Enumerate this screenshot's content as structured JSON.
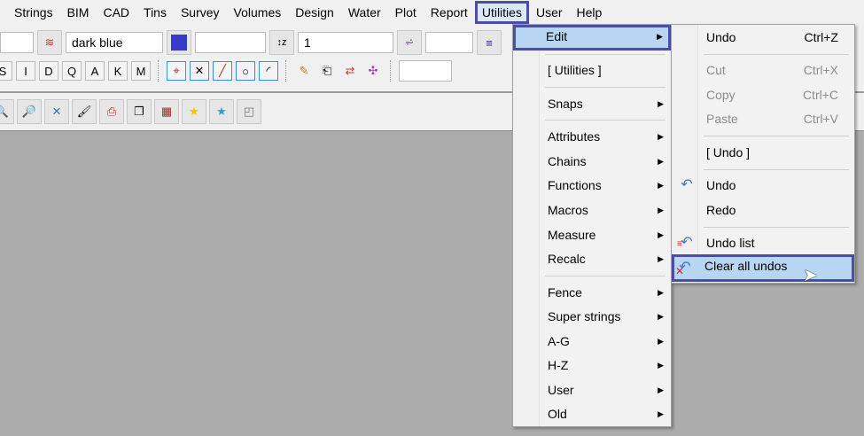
{
  "menubar": [
    "Strings",
    "BIM",
    "CAD",
    "Tins",
    "Survey",
    "Volumes",
    "Design",
    "Water",
    "Plot",
    "Report",
    "Utilities",
    "User",
    "Help"
  ],
  "toolbar": {
    "colour_value": "dark blue",
    "colour_swatch": "#3a3ac8",
    "weight_value": "1",
    "mode_buttons": [
      "S",
      "I",
      "D",
      "Q",
      "A",
      "K",
      "M"
    ]
  },
  "utilities_menu": {
    "items": [
      {
        "label": "Edit",
        "submenu": true
      },
      {
        "label": "[ Utilities ]"
      },
      {
        "label": "Snaps",
        "submenu": true
      },
      {
        "label": "Attributes",
        "submenu": true
      },
      {
        "label": "Chains",
        "submenu": true
      },
      {
        "label": "Functions",
        "submenu": true
      },
      {
        "label": "Macros",
        "submenu": true
      },
      {
        "label": "Measure",
        "submenu": true
      },
      {
        "label": "Recalc",
        "submenu": true
      },
      {
        "label": "Fence",
        "submenu": true
      },
      {
        "label": "Super strings",
        "submenu": true
      },
      {
        "label": "A-G",
        "submenu": true
      },
      {
        "label": "H-Z",
        "submenu": true
      },
      {
        "label": "User",
        "submenu": true
      },
      {
        "label": "Old",
        "submenu": true
      }
    ]
  },
  "edit_menu": {
    "items": [
      {
        "label": "Undo",
        "shortcut": "Ctrl+Z"
      },
      {
        "label": "Cut",
        "shortcut": "Ctrl+X"
      },
      {
        "label": "Copy",
        "shortcut": "Ctrl+C"
      },
      {
        "label": "Paste",
        "shortcut": "Ctrl+V"
      },
      {
        "label": "[ Undo ]"
      },
      {
        "label": "Undo"
      },
      {
        "label": "Redo"
      },
      {
        "label": "Undo list"
      },
      {
        "label": "Clear all undos"
      }
    ]
  },
  "colors": {
    "highlight": "#b7d6f2",
    "highlight_border": "#4b4fa3"
  }
}
